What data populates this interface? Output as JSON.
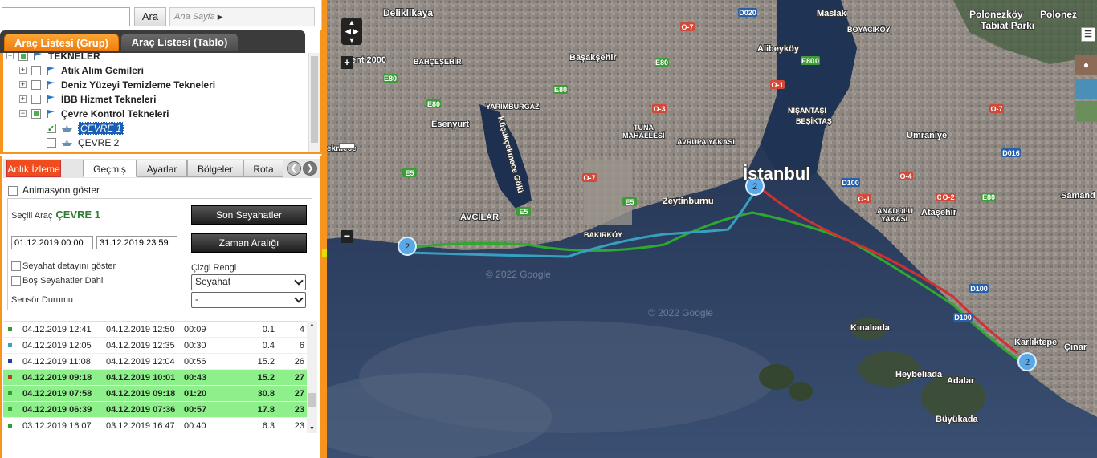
{
  "search": {
    "placeholder": "",
    "button": "Ara",
    "breadcrumb": "Ana Sayfa"
  },
  "top_tabs": {
    "grup": "Araç Listesi (Grup)",
    "tablo": "Araç Listesi (Tablo)"
  },
  "tree": {
    "root": "TEKNELER",
    "groups": [
      "Atık Alım Gemileri",
      "Deniz Yüzeyi Temizleme Tekneleri",
      "İBB Hizmet Tekneleri",
      "Çevre Kontrol Tekneleri"
    ],
    "vehicles": [
      "ÇEVRE 1",
      "ÇEVRE 2"
    ]
  },
  "bottom_tabs": {
    "anlik": "Anlık İzleme",
    "gecmis": "Geçmiş",
    "ayarlar": "Ayarlar",
    "bolgeler": "Bölgeler",
    "rota": "Rota"
  },
  "form": {
    "animasyon": "Animasyon göster",
    "secili_arac_label": "Seçili Araç",
    "secili_arac_value": "ÇEVRE 1",
    "son_seyahatler": "Son Seyahatler",
    "start_date": "01.12.2019 00:00",
    "end_date": "31.12.2019 23:59",
    "zaman_araligi": "Zaman Aralığı",
    "detay": "Seyahat detayını göster",
    "bos": "Boş Seyahatler Dahil",
    "cizgi_label": "Çizgi Rengi",
    "cizgi_value": "Seyahat",
    "sensor_label": "Sensör Durumu",
    "sensor_value": "-"
  },
  "trips": [
    {
      "color": "#2e9e2e",
      "start": "04.12.2019 12:41",
      "end": "04.12.2019 12:50",
      "dur": "00:09",
      "km": "0.1",
      "n": "4",
      "hl": false
    },
    {
      "color": "#3aa0c8",
      "start": "04.12.2019 12:05",
      "end": "04.12.2019 12:35",
      "dur": "00:30",
      "km": "0.4",
      "n": "6",
      "hl": false
    },
    {
      "color": "#1f3fa8",
      "start": "04.12.2019 11:08",
      "end": "04.12.2019 12:04",
      "dur": "00:56",
      "km": "15.2",
      "n": "26",
      "hl": false
    },
    {
      "color": "#c0392b",
      "start": "04.12.2019 09:18",
      "end": "04.12.2019 10:01",
      "dur": "00:43",
      "km": "15.2",
      "n": "27",
      "hl": true
    },
    {
      "color": "#2e9e2e",
      "start": "04.12.2019 07:58",
      "end": "04.12.2019 09:18",
      "dur": "01:20",
      "km": "30.8",
      "n": "27",
      "hl": true
    },
    {
      "color": "#2e9e2e",
      "start": "04.12.2019 06:39",
      "end": "04.12.2019 07:36",
      "dur": "00:57",
      "km": "17.8",
      "n": "23",
      "hl": true
    },
    {
      "color": "#2e9e2e",
      "start": "03.12.2019 16:07",
      "end": "03.12.2019 16:47",
      "dur": "00:40",
      "km": "6.3",
      "n": "23",
      "hl": false
    }
  ],
  "map": {
    "labels": {
      "istanbul": "İstanbul",
      "deliklikaya": "Deliklikaya",
      "basaksehir": "Başakşehir",
      "esenyurt": "Esenyurt",
      "yarimburgaz": "YARIMBURGAZ",
      "tuna": "TUNA",
      "mahallesi": "MAHALLESİ",
      "avrupa": "AVRUPA YAKASI",
      "bahcesehir": "BAHÇEŞEHİR",
      "avcilar": "AVCILAR",
      "bakirkoy": "BAKIRKÖY",
      "zeytinburnu": "Zeytinburnu",
      "kucukcekmece": "Küçükçekmece Gölü",
      "maslak": "Maslak",
      "alibeykoy": "Alibeyköy",
      "nisantasi": "NİŞANTAŞI",
      "besiktas": "BEŞİKTAŞ",
      "boyacikoy": "BOYACIKÖY",
      "polonezkoy": "Polonezköy",
      "tabiat": "Tabiat Parkı",
      "polonez": "Polonez",
      "umraniye": "Umraniye",
      "anadolu": "ANADOLU",
      "yakasi": "YAKASI",
      "atasehir": "Ataşehir",
      "kinaliada": "Kınalıada",
      "heybeliada": "Heybeliada",
      "adalar": "Adalar",
      "buyukada": "Büyükada",
      "kartaltepe": "Karlıktepe",
      "cinar": "Çınar",
      "samand": "Samand",
      "ekmece": "ekmece",
      "kent2000": "ent 2000",
      "google1": "© 2022 Google",
      "google2": "© 2022 Google",
      "cluster": "2"
    },
    "roads": [
      "D020",
      "O-7",
      "E80",
      "E80",
      "E80",
      "E80",
      "E80",
      "O-3",
      "O-1",
      "O-7",
      "O-2",
      "O-4",
      "D100",
      "D100",
      "D100",
      "D016",
      "E5",
      "E5",
      "E5",
      "E80",
      "O-1",
      "O-2",
      "E80",
      "O-7"
    ]
  }
}
